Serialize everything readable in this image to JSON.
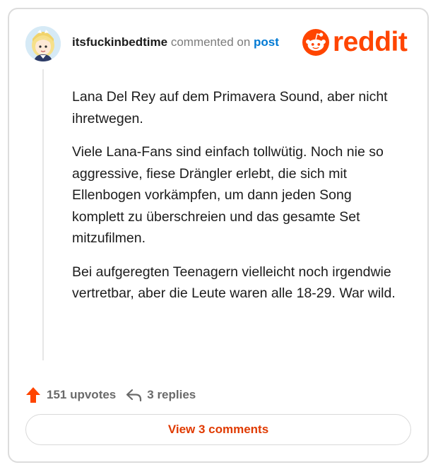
{
  "comment": {
    "author": "itsfuckinbedtime",
    "action_text": "commented on",
    "target_link": "post",
    "paragraphs": [
      "Lana Del Rey auf dem Primavera Sound, aber nicht ihretwegen.",
      "Viele Lana-Fans sind einfach tollwütig. Noch nie so aggressive, fiese Drängler erlebt, die sich mit Ellenbogen vorkämpfen, um dann jeden Song komplett zu überschreien und das gesamte Set mitzufilmen.",
      "Bei aufgeregten Teenagern vielleicht noch irgendwie vertretbar, aber die Leute waren alle 18-29. War wild."
    ],
    "upvotes": "151 upvotes",
    "replies": "3 replies",
    "view_button": "View 3 comments"
  },
  "brand": {
    "wordmark": "reddit",
    "icon": "reddit-snoo-icon",
    "color": "#ff4500"
  },
  "colors": {
    "link": "#0079d3",
    "upvote": "#ff4500",
    "button_text": "#e03a00",
    "muted": "#7c7c7c"
  }
}
